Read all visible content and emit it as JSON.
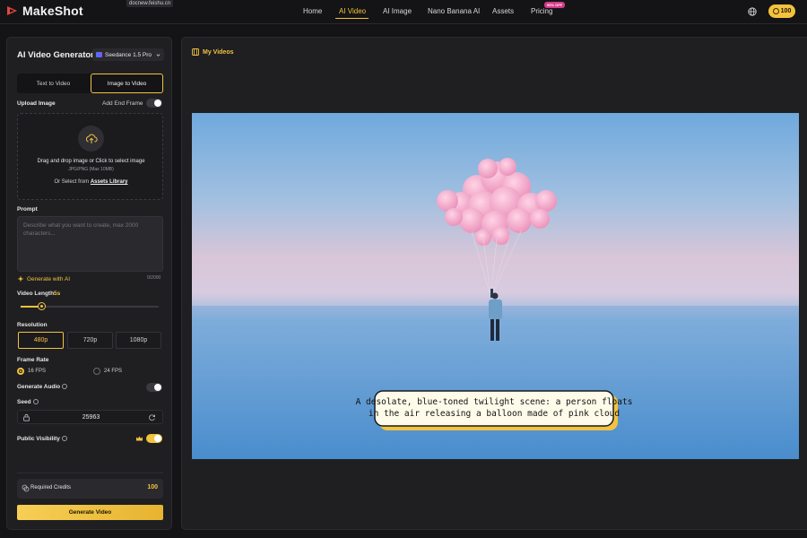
{
  "brand": {
    "name": "MakeShot"
  },
  "url_chip": "docnew.feishu.cn",
  "nav": {
    "items": [
      {
        "label": "Home"
      },
      {
        "label": "AI Video"
      },
      {
        "label": "AI Image"
      },
      {
        "label": "Nano Banana AI"
      },
      {
        "label": "Assets"
      },
      {
        "label": "Pricing"
      }
    ],
    "active_index": 1,
    "pricing_badge": "90% OFF",
    "credits": "100"
  },
  "panel": {
    "title": "AI Video Generator",
    "model": "Seedance 1.5 Pro",
    "tabs": [
      "Text to Video",
      "Image to Video"
    ],
    "active_tab_index": 1,
    "upload_label": "Upload Image",
    "end_frame_label": "Add End Frame",
    "end_frame_enabled": false,
    "upload_main": "Drag and drop image or Click to select image",
    "upload_sub": "JPG/PNG (Max 10MB)",
    "upload_or": "Or Select from",
    "assets_link": "Assets Library",
    "prompt_label": "Prompt",
    "prompt_placeholder": "Describe what you want to create, max 2000 characters...",
    "prompt_counter": "0/2000",
    "generate_ai": "Generate with AI",
    "video_length_label": "Video Length",
    "video_length_value": "5s",
    "video_length_fraction": 0.15,
    "resolution_label": "Resolution",
    "resolutions": [
      "480p",
      "720p",
      "1080p"
    ],
    "resolution_selected_index": 0,
    "frame_rate_label": "Frame Rate",
    "frame_rates": [
      "16 FPS",
      "24 FPS"
    ],
    "frame_rate_selected_index": 0,
    "audio_label": "Generate Audio",
    "audio_enabled": false,
    "seed_label": "Seed",
    "seed_value": "25963",
    "visibility_label": "Public Visibility",
    "visibility_enabled": true,
    "required_credits_label": "Required Credits",
    "required_credits_value": "100",
    "generate_button": "Generate Video"
  },
  "videos": {
    "title": "My Videos"
  },
  "colors": {
    "accent": "#f3c23f",
    "background": "#141416",
    "panel": "#1f1f22"
  }
}
